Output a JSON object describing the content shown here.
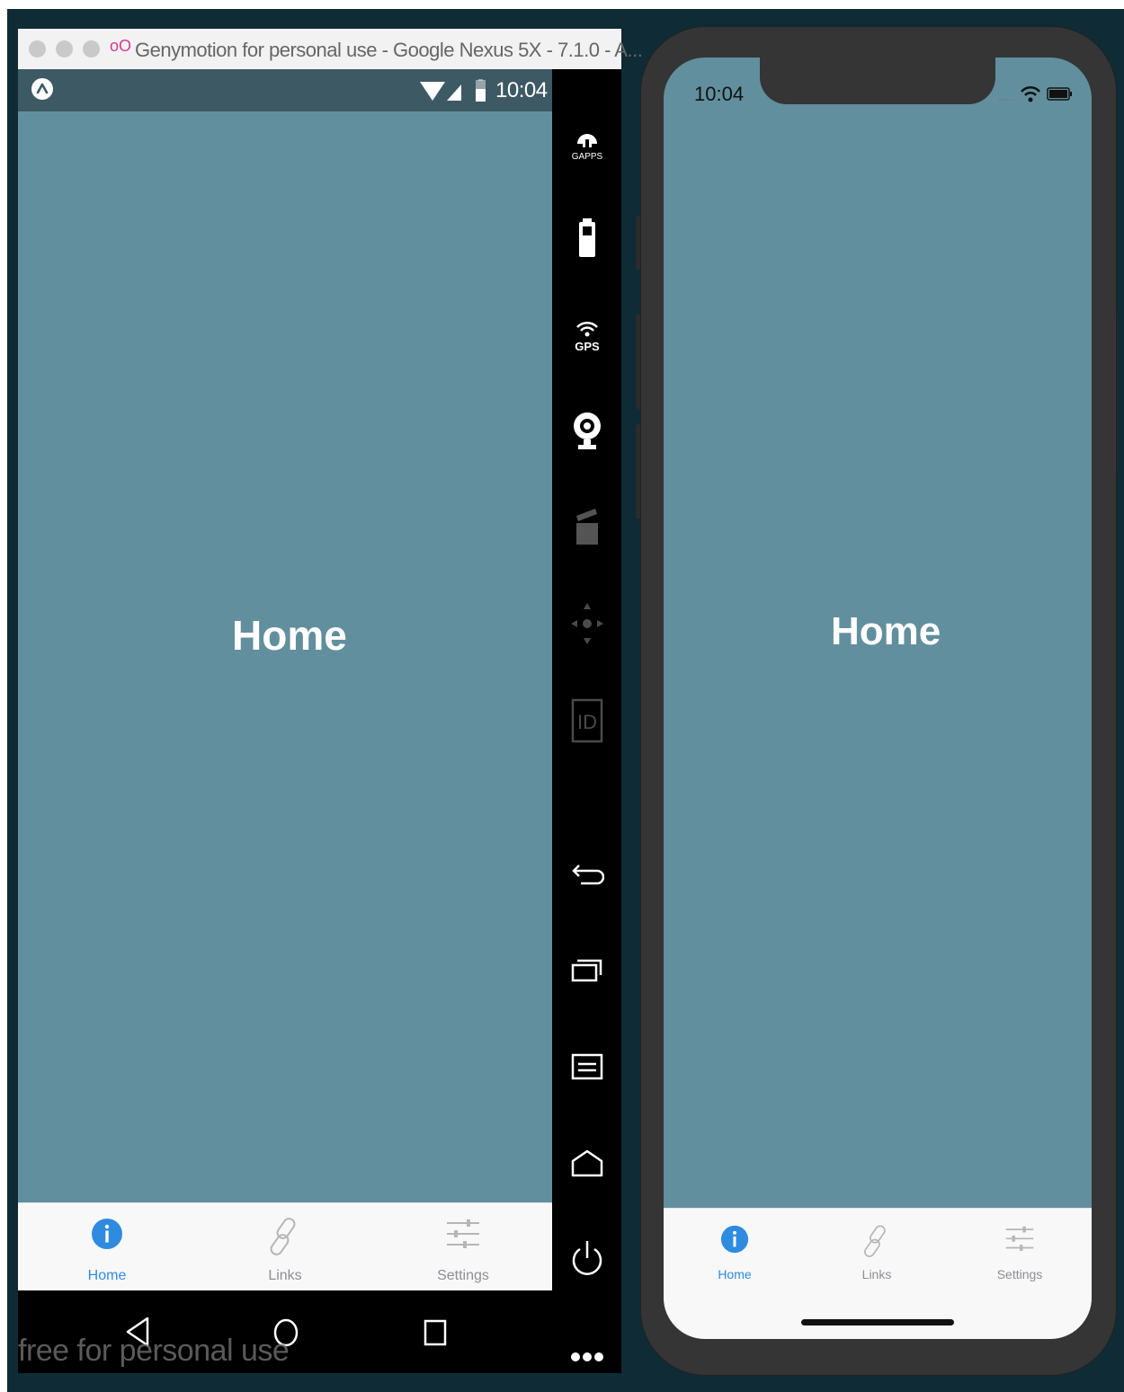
{
  "genymotion": {
    "window_title": "Genymotion for personal use - Google Nexus 5X - 7.1.0 - A...",
    "watermark": "free for personal use",
    "logo_glyph": "oO",
    "sidebar": [
      {
        "icon": "gapps-icon",
        "label": "GAPPS"
      },
      {
        "icon": "battery-icon"
      },
      {
        "icon": "gps-icon",
        "label": "GPS"
      },
      {
        "icon": "webcam-icon"
      },
      {
        "icon": "screencast-icon"
      },
      {
        "icon": "dpad-icon"
      },
      {
        "icon": "device-id-icon",
        "label": "ID"
      },
      {
        "icon": "back-icon"
      },
      {
        "icon": "recent-apps-icon"
      },
      {
        "icon": "menu-icon"
      },
      {
        "icon": "home-icon"
      },
      {
        "icon": "power-icon"
      },
      {
        "icon": "more-icon"
      }
    ]
  },
  "android": {
    "status_time": "10:04",
    "screen_title": "Home",
    "tabs": [
      {
        "label": "Home",
        "icon": "info-icon",
        "active": true
      },
      {
        "label": "Links",
        "icon": "link-icon",
        "active": false
      },
      {
        "label": "Settings",
        "icon": "sliders-icon",
        "active": false
      }
    ],
    "navbar": [
      "back-icon",
      "home-icon",
      "recents-icon"
    ]
  },
  "ios": {
    "status_time": "10:04",
    "screen_title": "Home",
    "tabs": [
      {
        "label": "Home",
        "icon": "info-icon",
        "active": true
      },
      {
        "label": "Links",
        "icon": "link-icon",
        "active": false
      },
      {
        "label": "Settings",
        "icon": "sliders-icon",
        "active": false
      }
    ]
  },
  "colors": {
    "content_bg": "#628f9e",
    "android_statusbar": "#3d5963",
    "active_tab": "#2f8be0",
    "inactive_tab": "#8e8e93",
    "desktop_bg": "#0f2b35"
  }
}
